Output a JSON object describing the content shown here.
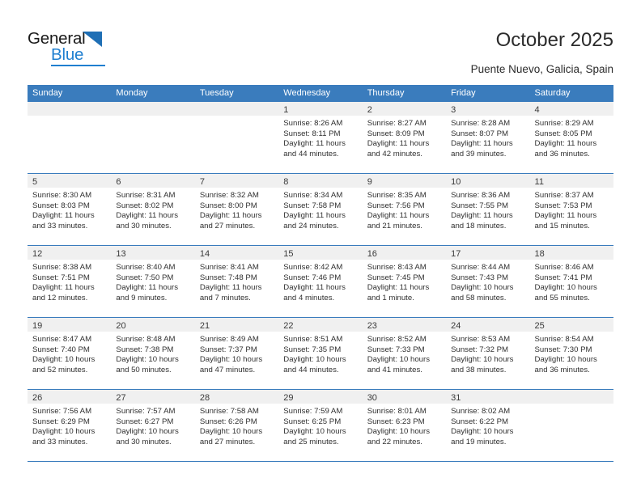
{
  "brand": {
    "name_dark": "General",
    "name_blue": "Blue",
    "triangle_icon": "triangle-icon",
    "accent_blue": "#1f7fd0",
    "header_blue": "#3a7cbd"
  },
  "header": {
    "title": "October 2025",
    "subtitle": "Puente Nuevo, Galicia, Spain"
  },
  "weekdays": [
    "Sunday",
    "Monday",
    "Tuesday",
    "Wednesday",
    "Thursday",
    "Friday",
    "Saturday"
  ],
  "labels": {
    "sunrise": "Sunrise:",
    "sunset": "Sunset:",
    "daylight": "Daylight:"
  },
  "weeks": [
    [
      {
        "day": "",
        "empty": true
      },
      {
        "day": "",
        "empty": true
      },
      {
        "day": "",
        "empty": true
      },
      {
        "day": "1",
        "sunrise": "Sunrise: 8:26 AM",
        "sunset": "Sunset: 8:11 PM",
        "daylight1": "Daylight: 11 hours",
        "daylight2": "and 44 minutes."
      },
      {
        "day": "2",
        "sunrise": "Sunrise: 8:27 AM",
        "sunset": "Sunset: 8:09 PM",
        "daylight1": "Daylight: 11 hours",
        "daylight2": "and 42 minutes."
      },
      {
        "day": "3",
        "sunrise": "Sunrise: 8:28 AM",
        "sunset": "Sunset: 8:07 PM",
        "daylight1": "Daylight: 11 hours",
        "daylight2": "and 39 minutes."
      },
      {
        "day": "4",
        "sunrise": "Sunrise: 8:29 AM",
        "sunset": "Sunset: 8:05 PM",
        "daylight1": "Daylight: 11 hours",
        "daylight2": "and 36 minutes."
      }
    ],
    [
      {
        "day": "5",
        "sunrise": "Sunrise: 8:30 AM",
        "sunset": "Sunset: 8:03 PM",
        "daylight1": "Daylight: 11 hours",
        "daylight2": "and 33 minutes."
      },
      {
        "day": "6",
        "sunrise": "Sunrise: 8:31 AM",
        "sunset": "Sunset: 8:02 PM",
        "daylight1": "Daylight: 11 hours",
        "daylight2": "and 30 minutes."
      },
      {
        "day": "7",
        "sunrise": "Sunrise: 8:32 AM",
        "sunset": "Sunset: 8:00 PM",
        "daylight1": "Daylight: 11 hours",
        "daylight2": "and 27 minutes."
      },
      {
        "day": "8",
        "sunrise": "Sunrise: 8:34 AM",
        "sunset": "Sunset: 7:58 PM",
        "daylight1": "Daylight: 11 hours",
        "daylight2": "and 24 minutes."
      },
      {
        "day": "9",
        "sunrise": "Sunrise: 8:35 AM",
        "sunset": "Sunset: 7:56 PM",
        "daylight1": "Daylight: 11 hours",
        "daylight2": "and 21 minutes."
      },
      {
        "day": "10",
        "sunrise": "Sunrise: 8:36 AM",
        "sunset": "Sunset: 7:55 PM",
        "daylight1": "Daylight: 11 hours",
        "daylight2": "and 18 minutes."
      },
      {
        "day": "11",
        "sunrise": "Sunrise: 8:37 AM",
        "sunset": "Sunset: 7:53 PM",
        "daylight1": "Daylight: 11 hours",
        "daylight2": "and 15 minutes."
      }
    ],
    [
      {
        "day": "12",
        "sunrise": "Sunrise: 8:38 AM",
        "sunset": "Sunset: 7:51 PM",
        "daylight1": "Daylight: 11 hours",
        "daylight2": "and 12 minutes."
      },
      {
        "day": "13",
        "sunrise": "Sunrise: 8:40 AM",
        "sunset": "Sunset: 7:50 PM",
        "daylight1": "Daylight: 11 hours",
        "daylight2": "and 9 minutes."
      },
      {
        "day": "14",
        "sunrise": "Sunrise: 8:41 AM",
        "sunset": "Sunset: 7:48 PM",
        "daylight1": "Daylight: 11 hours",
        "daylight2": "and 7 minutes."
      },
      {
        "day": "15",
        "sunrise": "Sunrise: 8:42 AM",
        "sunset": "Sunset: 7:46 PM",
        "daylight1": "Daylight: 11 hours",
        "daylight2": "and 4 minutes."
      },
      {
        "day": "16",
        "sunrise": "Sunrise: 8:43 AM",
        "sunset": "Sunset: 7:45 PM",
        "daylight1": "Daylight: 11 hours",
        "daylight2": "and 1 minute."
      },
      {
        "day": "17",
        "sunrise": "Sunrise: 8:44 AM",
        "sunset": "Sunset: 7:43 PM",
        "daylight1": "Daylight: 10 hours",
        "daylight2": "and 58 minutes."
      },
      {
        "day": "18",
        "sunrise": "Sunrise: 8:46 AM",
        "sunset": "Sunset: 7:41 PM",
        "daylight1": "Daylight: 10 hours",
        "daylight2": "and 55 minutes."
      }
    ],
    [
      {
        "day": "19",
        "sunrise": "Sunrise: 8:47 AM",
        "sunset": "Sunset: 7:40 PM",
        "daylight1": "Daylight: 10 hours",
        "daylight2": "and 52 minutes."
      },
      {
        "day": "20",
        "sunrise": "Sunrise: 8:48 AM",
        "sunset": "Sunset: 7:38 PM",
        "daylight1": "Daylight: 10 hours",
        "daylight2": "and 50 minutes."
      },
      {
        "day": "21",
        "sunrise": "Sunrise: 8:49 AM",
        "sunset": "Sunset: 7:37 PM",
        "daylight1": "Daylight: 10 hours",
        "daylight2": "and 47 minutes."
      },
      {
        "day": "22",
        "sunrise": "Sunrise: 8:51 AM",
        "sunset": "Sunset: 7:35 PM",
        "daylight1": "Daylight: 10 hours",
        "daylight2": "and 44 minutes."
      },
      {
        "day": "23",
        "sunrise": "Sunrise: 8:52 AM",
        "sunset": "Sunset: 7:33 PM",
        "daylight1": "Daylight: 10 hours",
        "daylight2": "and 41 minutes."
      },
      {
        "day": "24",
        "sunrise": "Sunrise: 8:53 AM",
        "sunset": "Sunset: 7:32 PM",
        "daylight1": "Daylight: 10 hours",
        "daylight2": "and 38 minutes."
      },
      {
        "day": "25",
        "sunrise": "Sunrise: 8:54 AM",
        "sunset": "Sunset: 7:30 PM",
        "daylight1": "Daylight: 10 hours",
        "daylight2": "and 36 minutes."
      }
    ],
    [
      {
        "day": "26",
        "sunrise": "Sunrise: 7:56 AM",
        "sunset": "Sunset: 6:29 PM",
        "daylight1": "Daylight: 10 hours",
        "daylight2": "and 33 minutes."
      },
      {
        "day": "27",
        "sunrise": "Sunrise: 7:57 AM",
        "sunset": "Sunset: 6:27 PM",
        "daylight1": "Daylight: 10 hours",
        "daylight2": "and 30 minutes."
      },
      {
        "day": "28",
        "sunrise": "Sunrise: 7:58 AM",
        "sunset": "Sunset: 6:26 PM",
        "daylight1": "Daylight: 10 hours",
        "daylight2": "and 27 minutes."
      },
      {
        "day": "29",
        "sunrise": "Sunrise: 7:59 AM",
        "sunset": "Sunset: 6:25 PM",
        "daylight1": "Daylight: 10 hours",
        "daylight2": "and 25 minutes."
      },
      {
        "day": "30",
        "sunrise": "Sunrise: 8:01 AM",
        "sunset": "Sunset: 6:23 PM",
        "daylight1": "Daylight: 10 hours",
        "daylight2": "and 22 minutes."
      },
      {
        "day": "31",
        "sunrise": "Sunrise: 8:02 AM",
        "sunset": "Sunset: 6:22 PM",
        "daylight1": "Daylight: 10 hours",
        "daylight2": "and 19 minutes."
      },
      {
        "day": "",
        "empty": true
      }
    ]
  ]
}
